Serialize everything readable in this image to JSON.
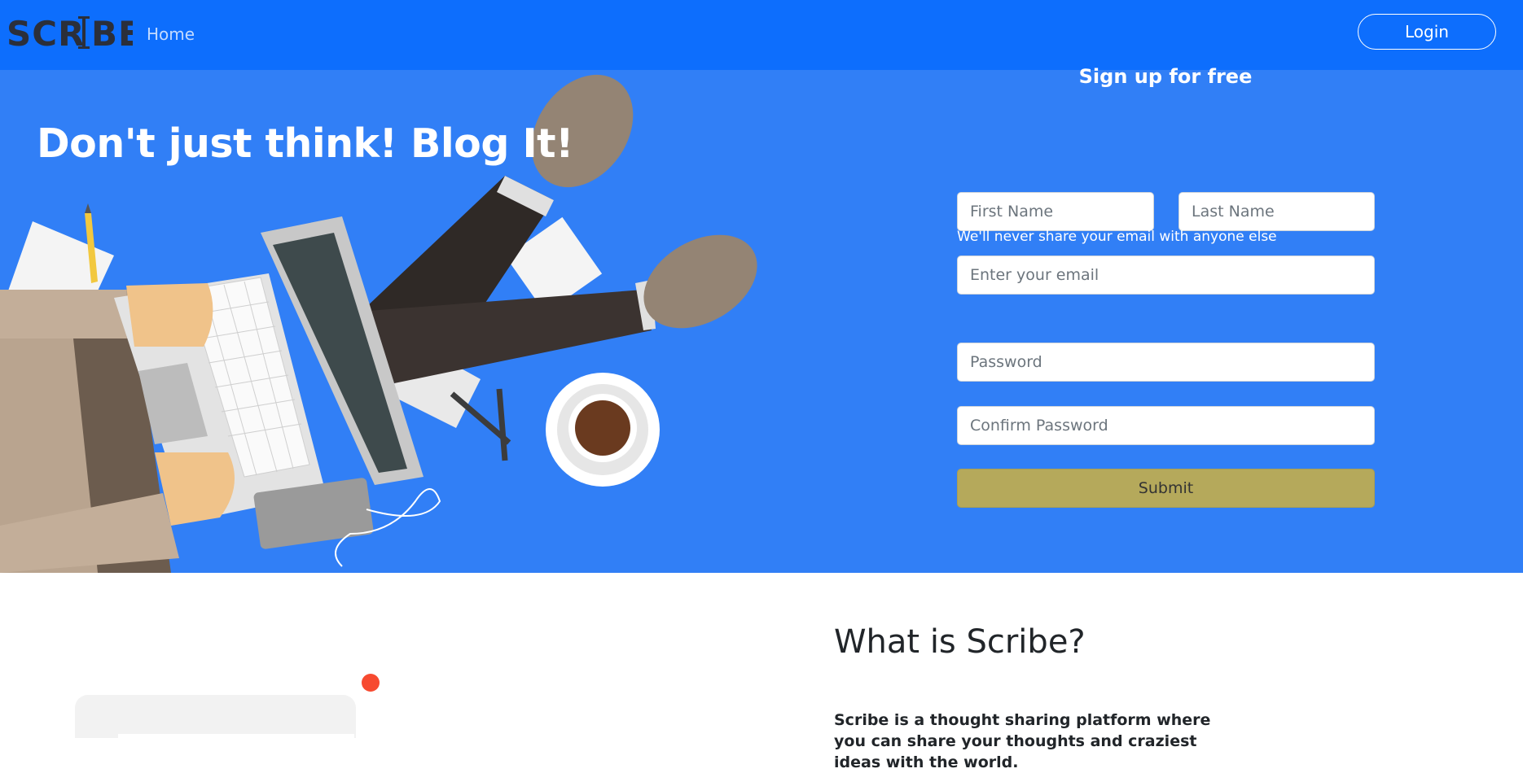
{
  "navbar": {
    "brand": "SCRIBE",
    "home_label": "Home",
    "login_label": "Login",
    "bg_color": "#0d6efd"
  },
  "hero": {
    "title": "Don't just think! Blog It!",
    "bg_color": "#317ff6"
  },
  "signup": {
    "title": "Sign up for free",
    "first_name_placeholder": "First Name",
    "last_name_placeholder": "Last Name",
    "email_placeholder": "Enter your email",
    "email_help": "We'll never share your email with anyone else",
    "password_placeholder": "Password",
    "confirm_password_placeholder": "Confirm Password",
    "submit_label": "Submit",
    "submit_color": "#b5a95b"
  },
  "about": {
    "title": "What is Scribe?",
    "text": "Scribe is a thought sharing platform where you can share your thoughts and craziest ideas with the world."
  }
}
